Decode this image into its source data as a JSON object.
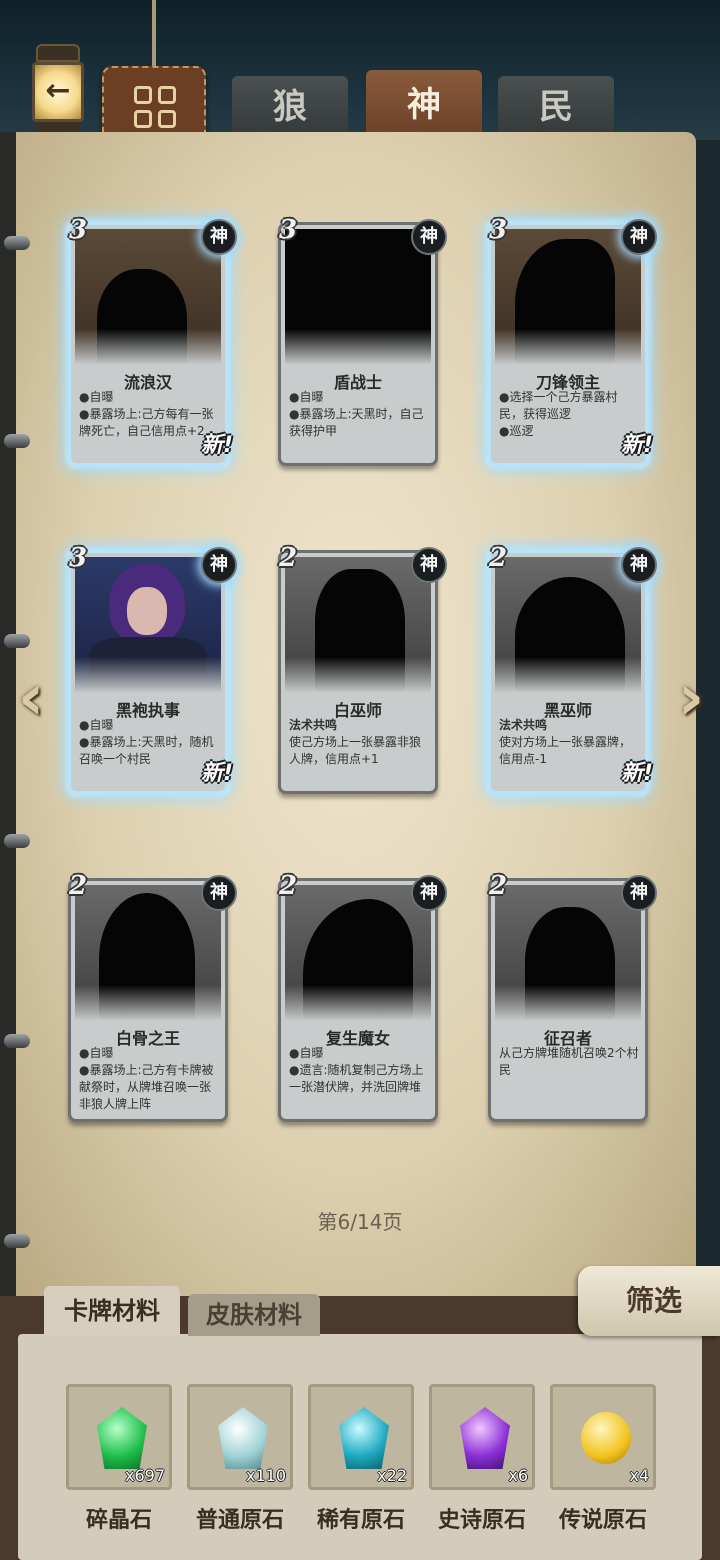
{
  "header": {
    "back_icon": "←",
    "tabs": [
      "狼",
      "神",
      "民"
    ],
    "active_tab": "神"
  },
  "cards": [
    {
      "cost": "3",
      "faction": "神",
      "name": "流浪汉",
      "lines": [
        "●自曝",
        "●暴露场上:己方每有一张牌死亡，自己信用点+2"
      ],
      "new": "新!"
    },
    {
      "cost": "3",
      "faction": "神",
      "name": "盾战士",
      "lines": [
        "●自曝",
        "●暴露场上:天黑时，自己获得护甲"
      ],
      "new": ""
    },
    {
      "cost": "3",
      "faction": "神",
      "name": "刀锋领主",
      "lines": [
        "●选择一个己方暴露村民，获得巡逻",
        "●巡逻"
      ],
      "new": "新!"
    },
    {
      "cost": "3",
      "faction": "神",
      "name": "黑袍执事",
      "lines": [
        "●自曝",
        "●暴露场上:天黑时，随机召唤一个村民"
      ],
      "new": "新!"
    },
    {
      "cost": "2",
      "faction": "神",
      "name": "白巫师",
      "lines": [
        "法术共鸣",
        "使己方场上一张暴露非狼人牌，信用点+1"
      ],
      "new": ""
    },
    {
      "cost": "2",
      "faction": "神",
      "name": "黑巫师",
      "lines": [
        "法术共鸣",
        "使对方场上一张暴露牌，信用点-1"
      ],
      "new": "新!"
    },
    {
      "cost": "2",
      "faction": "神",
      "name": "白骨之王",
      "lines": [
        "●自曝",
        "●暴露场上:己方有卡牌被献祭时，从牌堆召唤一张非狼人牌上阵"
      ],
      "new": ""
    },
    {
      "cost": "2",
      "faction": "神",
      "name": "复生魔女",
      "lines": [
        "●自曝",
        "●遗言:随机复制己方场上一张潜伏牌，并洗回牌堆"
      ],
      "new": ""
    },
    {
      "cost": "2",
      "faction": "神",
      "name": "征召者",
      "lines": [
        "",
        "从己方牌堆随机召唤2个村民"
      ],
      "new": ""
    }
  ],
  "pager": {
    "text": "第6/14页",
    "prev_icon": "‹",
    "next_icon": "›"
  },
  "materials": {
    "tabs": [
      "卡牌材料",
      "皮肤材料"
    ],
    "filter_label": "筛选",
    "items": [
      {
        "name": "碎晶石",
        "count": "x697",
        "color": "#1fbf4a"
      },
      {
        "name": "普通原石",
        "count": "x110",
        "color": "#9fd3d6"
      },
      {
        "name": "稀有原石",
        "count": "x22",
        "color": "#1fa9c0"
      },
      {
        "name": "史诗原石",
        "count": "x6",
        "color": "#8a2fd6"
      },
      {
        "name": "传说原石",
        "count": "x4",
        "color": "#f2c21c"
      }
    ]
  }
}
